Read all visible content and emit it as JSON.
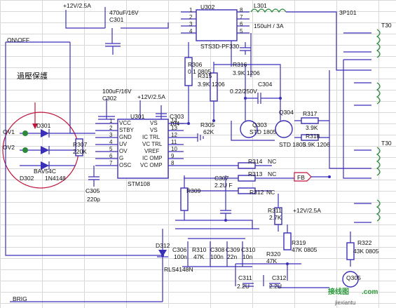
{
  "note": {
    "text": "過壓保護"
  },
  "ports": {
    "onoff": "ON\\OFF",
    "brig": "BRIG",
    "fb": "FB",
    "ov1": "OV1",
    "ov2": "OV2",
    "j3": "3P101",
    "t1": "T30",
    "t2": "T30"
  },
  "supply": {
    "top": "+12V/2.5A",
    "mid": "+12V/2.5A",
    "low": "+12V/2.5A"
  },
  "chips": {
    "u301": {
      "name": "U301",
      "part": "STM108",
      "left_pins": [
        "VCC",
        "STBY",
        "GND",
        "UV",
        "OV",
        "G",
        "OSC"
      ],
      "right_pins": [
        "VS",
        "VS",
        "IC TRL",
        "VC TRL",
        "VREF",
        "IC OMP",
        "VC OMP"
      ],
      "left_nums": [
        "1",
        "2",
        "3",
        "4",
        "5",
        "6",
        "7"
      ],
      "right_nums": [
        "14",
        "13",
        "12",
        "11",
        "10",
        "9",
        "8"
      ]
    },
    "u302": {
      "name": "U302",
      "part": "STS3D-PF330",
      "left_nums": [
        "1",
        "2",
        "3",
        "4"
      ],
      "right_nums": [
        "8",
        "7",
        "6",
        "5"
      ]
    }
  },
  "parts": {
    "c301": {
      "ref": "C301",
      "val": "470uF/16V"
    },
    "l301": {
      "ref": "L301",
      "val": "150uH / 3A"
    },
    "c302": {
      "ref": "C302",
      "val": "100uF/16V"
    },
    "c303": {
      "ref": "C303",
      "val": "104"
    },
    "c304": {
      "ref": "C304",
      "val": "0.22/250V"
    },
    "r306": {
      "ref": "R306",
      "val": "0.1 0805"
    },
    "r315": {
      "ref": "R315",
      "val": "3.9K 1206"
    },
    "r316": {
      "ref": "R316",
      "val": "3.9K 1206"
    },
    "r305": {
      "ref": "R305",
      "val": "62K"
    },
    "q303": {
      "ref": "Q303",
      "val": "STD 1805"
    },
    "q304": {
      "ref": "Q304",
      "val": "STD 1805"
    },
    "r317": {
      "ref": "R317",
      "val": "3.9K"
    },
    "r318": {
      "ref": "R318",
      "val": "3.9K 1206"
    },
    "r307": {
      "ref": "R307",
      "val": "220K"
    },
    "d301": {
      "ref": "D301",
      "val": "BAV54C"
    },
    "d302": {
      "ref": "D302",
      "val": "1N4148"
    },
    "c305": {
      "ref": "C305",
      "val": "220p"
    },
    "r309": {
      "ref": "R309",
      "val": ""
    },
    "c307": {
      "ref": "C307",
      "val": "2.2U F"
    },
    "r314": {
      "ref": "R314",
      "val": "NC"
    },
    "r313": {
      "ref": "R313",
      "val": "NC"
    },
    "r312": {
      "ref": "R312",
      "val": "NC"
    },
    "r311": {
      "ref": "R311",
      "val": "2.7K"
    },
    "d312": {
      "ref": "D312",
      "val": "RLS4148N"
    },
    "c306": {
      "ref": "C306",
      "val": "100n"
    },
    "r310": {
      "ref": "R310",
      "val": "47K"
    },
    "c308": {
      "ref": "C308",
      "val": "100n"
    },
    "c309": {
      "ref": "C309",
      "val": "22n"
    },
    "c310": {
      "ref": "C310",
      "val": "10n"
    },
    "r319": {
      "ref": "R319",
      "val": "47K 0805"
    },
    "r320": {
      "ref": "R320",
      "val": "47K"
    },
    "c311": {
      "ref": "C311",
      "val": "2.2U"
    },
    "c312": {
      "ref": "C312",
      "val": "2.2U"
    },
    "r322": {
      "ref": "R322",
      "val": "43K 0805"
    },
    "q305": {
      "ref": "Q305",
      "val": ""
    }
  },
  "watermark": {
    "brand": "接线图",
    "site": "jiexiantu",
    "dotcom": ".com"
  }
}
